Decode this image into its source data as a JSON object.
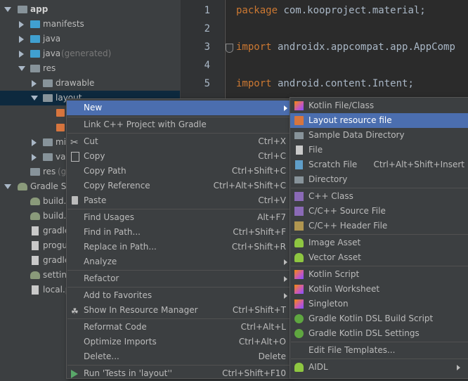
{
  "tree": {
    "items": [
      {
        "label": "app",
        "generated": ""
      },
      {
        "label": "manifests",
        "generated": ""
      },
      {
        "label": "java",
        "generated": ""
      },
      {
        "label": "java",
        "generated": "(generated)"
      },
      {
        "label": "res",
        "generated": ""
      },
      {
        "label": "drawable",
        "generated": ""
      },
      {
        "label": "layout",
        "generated": ""
      },
      {
        "label": "mi",
        "generated": ""
      },
      {
        "label": "val",
        "generated": ""
      },
      {
        "label": "res",
        "generated": "(ge"
      },
      {
        "label": "Gradle Sc",
        "generated": ""
      },
      {
        "label": "build.g",
        "generated": ""
      },
      {
        "label": "build.g",
        "generated": ""
      },
      {
        "label": "gradle",
        "generated": ""
      },
      {
        "label": "progua",
        "generated": ""
      },
      {
        "label": "gradle",
        "generated": ""
      },
      {
        "label": "setting",
        "generated": ""
      },
      {
        "label": "local.p",
        "generated": ""
      }
    ]
  },
  "editor": {
    "lines": [
      {
        "num": "1",
        "kw": "package",
        "rest": " com.kooproject.material;"
      },
      {
        "num": "2",
        "kw": "",
        "rest": ""
      },
      {
        "num": "3",
        "kw": "import",
        "rest": " androidx.appcompat.app.AppComp"
      },
      {
        "num": "4",
        "kw": "",
        "rest": ""
      },
      {
        "num": "5",
        "kw": "import",
        "rest": " android.content.Intent;"
      }
    ]
  },
  "context_menu": {
    "items": [
      {
        "label": "New",
        "shortcut": ""
      },
      {
        "label": "Link C++ Project with Gradle",
        "shortcut": ""
      },
      {
        "label": "Cut",
        "shortcut": "Ctrl+X"
      },
      {
        "label": "Copy",
        "shortcut": "Ctrl+C"
      },
      {
        "label": "Copy Path",
        "shortcut": "Ctrl+Shift+C"
      },
      {
        "label": "Copy Reference",
        "shortcut": "Ctrl+Alt+Shift+C"
      },
      {
        "label": "Paste",
        "shortcut": "Ctrl+V"
      },
      {
        "label": "Find Usages",
        "shortcut": "Alt+F7"
      },
      {
        "label": "Find in Path...",
        "shortcut": "Ctrl+Shift+F"
      },
      {
        "label": "Replace in Path...",
        "shortcut": "Ctrl+Shift+R"
      },
      {
        "label": "Analyze",
        "shortcut": ""
      },
      {
        "label": "Refactor",
        "shortcut": ""
      },
      {
        "label": "Add to Favorites",
        "shortcut": ""
      },
      {
        "label": "Show In Resource Manager",
        "shortcut": "Ctrl+Shift+T"
      },
      {
        "label": "Reformat Code",
        "shortcut": "Ctrl+Alt+L"
      },
      {
        "label": "Optimize Imports",
        "shortcut": "Ctrl+Alt+O"
      },
      {
        "label": "Delete...",
        "shortcut": "Delete"
      },
      {
        "label": "Run 'Tests in 'layout''",
        "shortcut": "Ctrl+Shift+F10"
      }
    ]
  },
  "new_submenu": {
    "items": [
      {
        "label": "Kotlin File/Class",
        "shortcut": ""
      },
      {
        "label": "Layout resource file",
        "shortcut": ""
      },
      {
        "label": "Sample Data Directory",
        "shortcut": ""
      },
      {
        "label": "File",
        "shortcut": ""
      },
      {
        "label": "Scratch File",
        "shortcut": "Ctrl+Alt+Shift+Insert"
      },
      {
        "label": "Directory",
        "shortcut": ""
      },
      {
        "label": "C++ Class",
        "shortcut": ""
      },
      {
        "label": "C/C++ Source File",
        "shortcut": ""
      },
      {
        "label": "C/C++ Header File",
        "shortcut": ""
      },
      {
        "label": "Image Asset",
        "shortcut": ""
      },
      {
        "label": "Vector Asset",
        "shortcut": ""
      },
      {
        "label": "Kotlin Script",
        "shortcut": ""
      },
      {
        "label": "Kotlin Worksheet",
        "shortcut": ""
      },
      {
        "label": "Singleton",
        "shortcut": ""
      },
      {
        "label": "Gradle Kotlin DSL Build Script",
        "shortcut": ""
      },
      {
        "label": "Gradle Kotlin DSL Settings",
        "shortcut": ""
      },
      {
        "label": "Edit File Templates...",
        "shortcut": ""
      },
      {
        "label": "AIDL",
        "shortcut": ""
      }
    ]
  },
  "colors": {
    "highlight": "#4b6eaf",
    "keyword": "#cc7832",
    "panel": "#3c3f41",
    "editor": "#2b2b2b"
  }
}
